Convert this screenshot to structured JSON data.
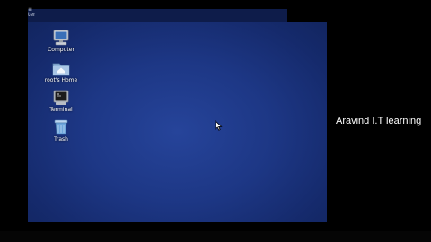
{
  "desktop": {
    "icons": [
      {
        "label": "Computer",
        "icon": "computer-icon"
      },
      {
        "label": "root's Home",
        "icon": "home-folder-icon"
      },
      {
        "label": "Terminal",
        "icon": "terminal-icon"
      },
      {
        "label": "Trash",
        "icon": "trash-icon"
      }
    ],
    "corner_glyphs": [
      "≡",
      "ter"
    ]
  },
  "overlay": {
    "caption": "Aravind  I.T learning"
  },
  "colors": {
    "desktop_background": "#1d3785",
    "outer_background": "#000000",
    "label_text": "#ffffff"
  }
}
